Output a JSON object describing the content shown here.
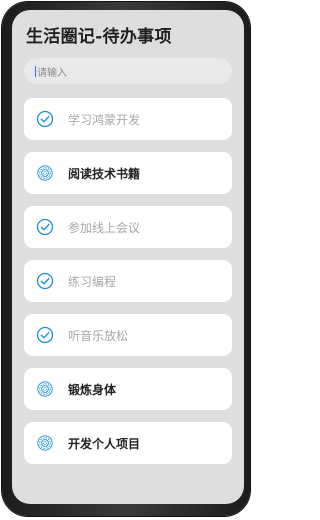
{
  "app": {
    "title": "生活圈记-待办事项"
  },
  "search": {
    "placeholder": "请输入",
    "value": ""
  },
  "todos": [
    {
      "label": "学习鸿蒙开发",
      "done": true,
      "icon": "check-circle-icon"
    },
    {
      "label": "阅读技术书籍",
      "done": false,
      "icon": "pending-circle-icon"
    },
    {
      "label": "参加线上会议",
      "done": true,
      "icon": "check-circle-icon"
    },
    {
      "label": "练习编程",
      "done": true,
      "icon": "check-circle-icon"
    },
    {
      "label": "听音乐放松",
      "done": true,
      "icon": "check-circle-icon"
    },
    {
      "label": "锻炼身体",
      "done": false,
      "icon": "pending-circle-icon"
    },
    {
      "label": "开发个人项目",
      "done": false,
      "icon": "pending-circle-icon"
    }
  ],
  "colors": {
    "accent": "#1a8fd6",
    "background": "#dedede",
    "card": "#ffffff",
    "done_text": "#a8a8a8",
    "todo_text": "#222222"
  }
}
